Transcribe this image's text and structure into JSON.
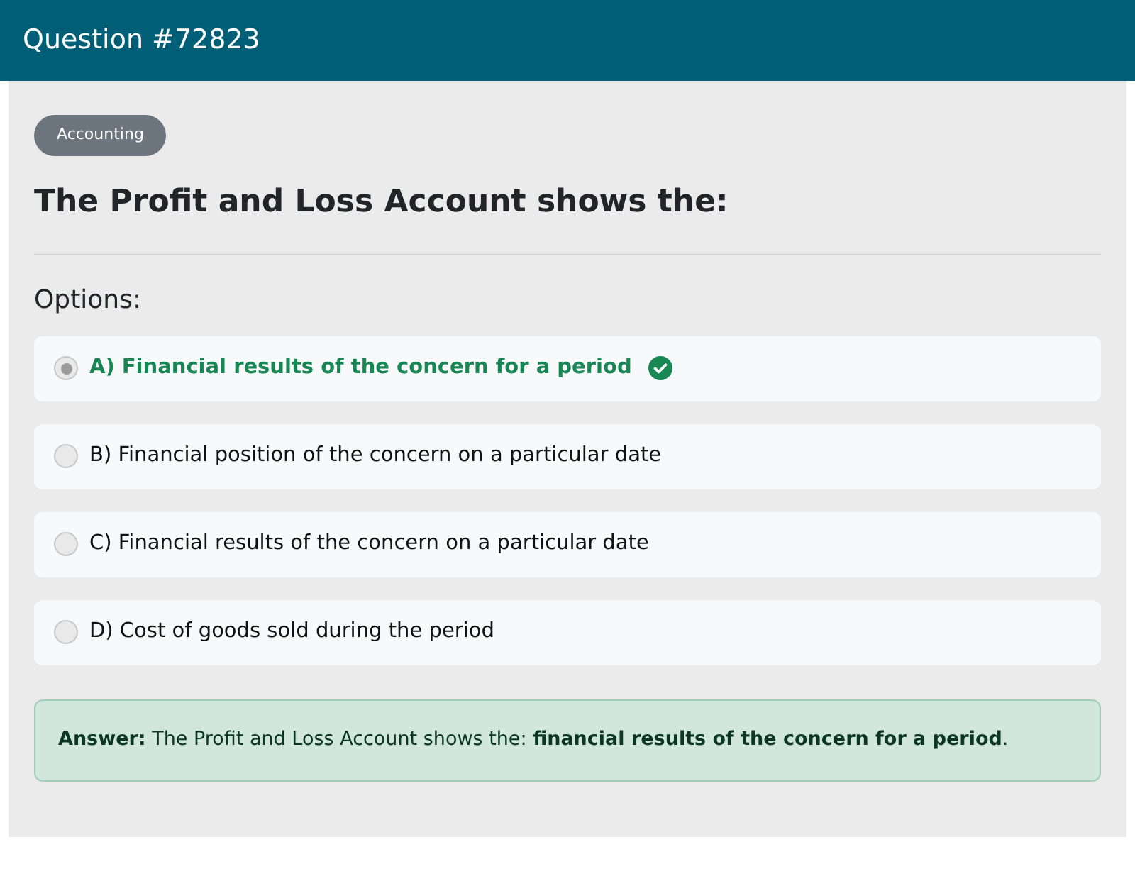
{
  "header": {
    "title": "Question #72823"
  },
  "category": "Accounting",
  "question": "The Profit and Loss Account shows the:",
  "options_label": "Options:",
  "options": [
    {
      "label": "A) Financial results of the concern for a period",
      "selected": true,
      "correct": true
    },
    {
      "label": "B) Financial position of the concern on a particular date",
      "selected": false,
      "correct": false
    },
    {
      "label": "C) Financial results of the concern on a particular date",
      "selected": false,
      "correct": false
    },
    {
      "label": "D) Cost of goods sold during the period",
      "selected": false,
      "correct": false
    }
  ],
  "answer": "**Answer:** The Profit and Loss Account shows the: **financial results of the concern for a period**."
}
